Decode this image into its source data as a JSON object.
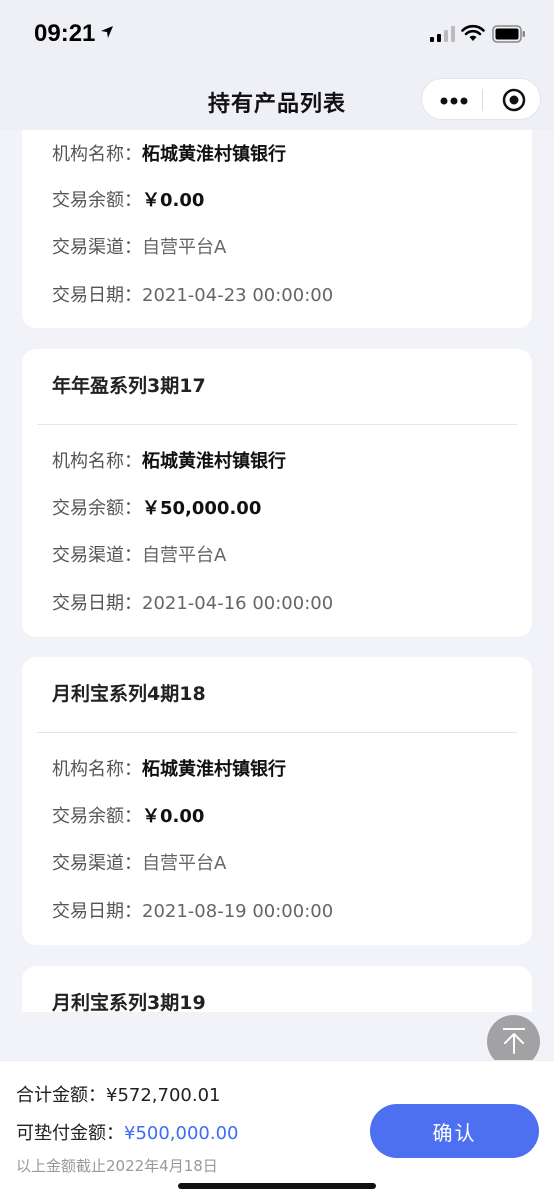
{
  "status": {
    "time": "09:21"
  },
  "nav": {
    "title": "持有产品列表"
  },
  "labels": {
    "institution": "机构名称：",
    "balance": "交易余额：",
    "channel": "交易渠道：",
    "date": "交易日期："
  },
  "cards": [
    {
      "title": "",
      "institution": "柘城黄淮村镇银行",
      "balance": "￥0.00",
      "channel": "自营平台A",
      "date": "2021-04-23 00:00:00"
    },
    {
      "title": "年年盈系列3期17",
      "institution": "柘城黄淮村镇银行",
      "balance": "￥50,000.00",
      "channel": "自营平台A",
      "date": "2021-04-16 00:00:00"
    },
    {
      "title": "月利宝系列4期18",
      "institution": "柘城黄淮村镇银行",
      "balance": "￥0.00",
      "channel": "自营平台A",
      "date": "2021-08-19 00:00:00"
    },
    {
      "title": "月利宝系列3期19"
    }
  ],
  "bottom": {
    "total_label": "合计金额：",
    "total_value": "¥572,700.01",
    "advance_label": "可垫付金额：",
    "advance_value": "¥500,000.00",
    "note": "以上金额截止2022年4月18日",
    "confirm_label": "确认"
  },
  "colors": {
    "accent": "#4c70f0",
    "advance_value": "#3d6df2"
  },
  "icons": [
    "location-arrow-icon",
    "signal-icon",
    "wifi-icon",
    "battery-icon",
    "more-icon",
    "target-icon",
    "back-to-top-icon"
  ]
}
